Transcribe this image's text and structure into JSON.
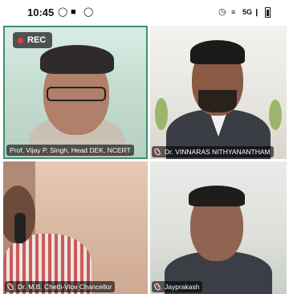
{
  "status_bar": {
    "time": "10:45",
    "left_icons": [
      "whatsapp-icon",
      "video-camera-icon",
      "whatsapp-icon"
    ],
    "right_icons": [
      "alarm-icon",
      "wifi-icon",
      "signal-5g-icon",
      "battery-icon"
    ],
    "network_label": "5G"
  },
  "meeting": {
    "recording_label": "REC",
    "active_speaker_border": "#3f8f73",
    "participants": [
      {
        "name": "Prof. Vijay P. Singh, Head DEK, NCERT",
        "muted": false
      },
      {
        "name": "Dr. VINNARAS NITHYANANTHAM",
        "muted": true
      },
      {
        "name": "Dr. M.B. Chetti-Vice Chancellor",
        "muted": true
      },
      {
        "name": "Jayprakash",
        "muted": true
      }
    ]
  }
}
